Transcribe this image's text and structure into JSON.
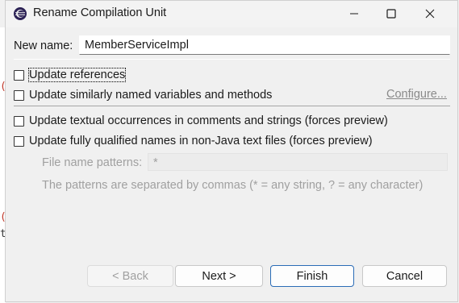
{
  "window": {
    "title": "Rename Compilation Unit"
  },
  "name_field": {
    "label": "New name:",
    "value": "MemberServiceImpl"
  },
  "options": {
    "update_references": "Update references",
    "update_similar": "Update similarly named variables and methods",
    "configure_link": "Configure...",
    "update_textual": "Update textual occurrences in comments and strings (forces preview)",
    "update_qualified": "Update fully qualified names in non-Java text files (forces preview)"
  },
  "file_patterns": {
    "label": "File name patterns:",
    "value": "*",
    "hint": "The patterns are separated by commas (* = any string, ? = any character)"
  },
  "buttons": {
    "back": "< Back",
    "next": "Next >",
    "finish": "Finish",
    "cancel": "Cancel"
  },
  "colors": {
    "accent": "#2b6cb6",
    "disabled_text": "#a0a0a0",
    "background": "#f0f0f0"
  }
}
